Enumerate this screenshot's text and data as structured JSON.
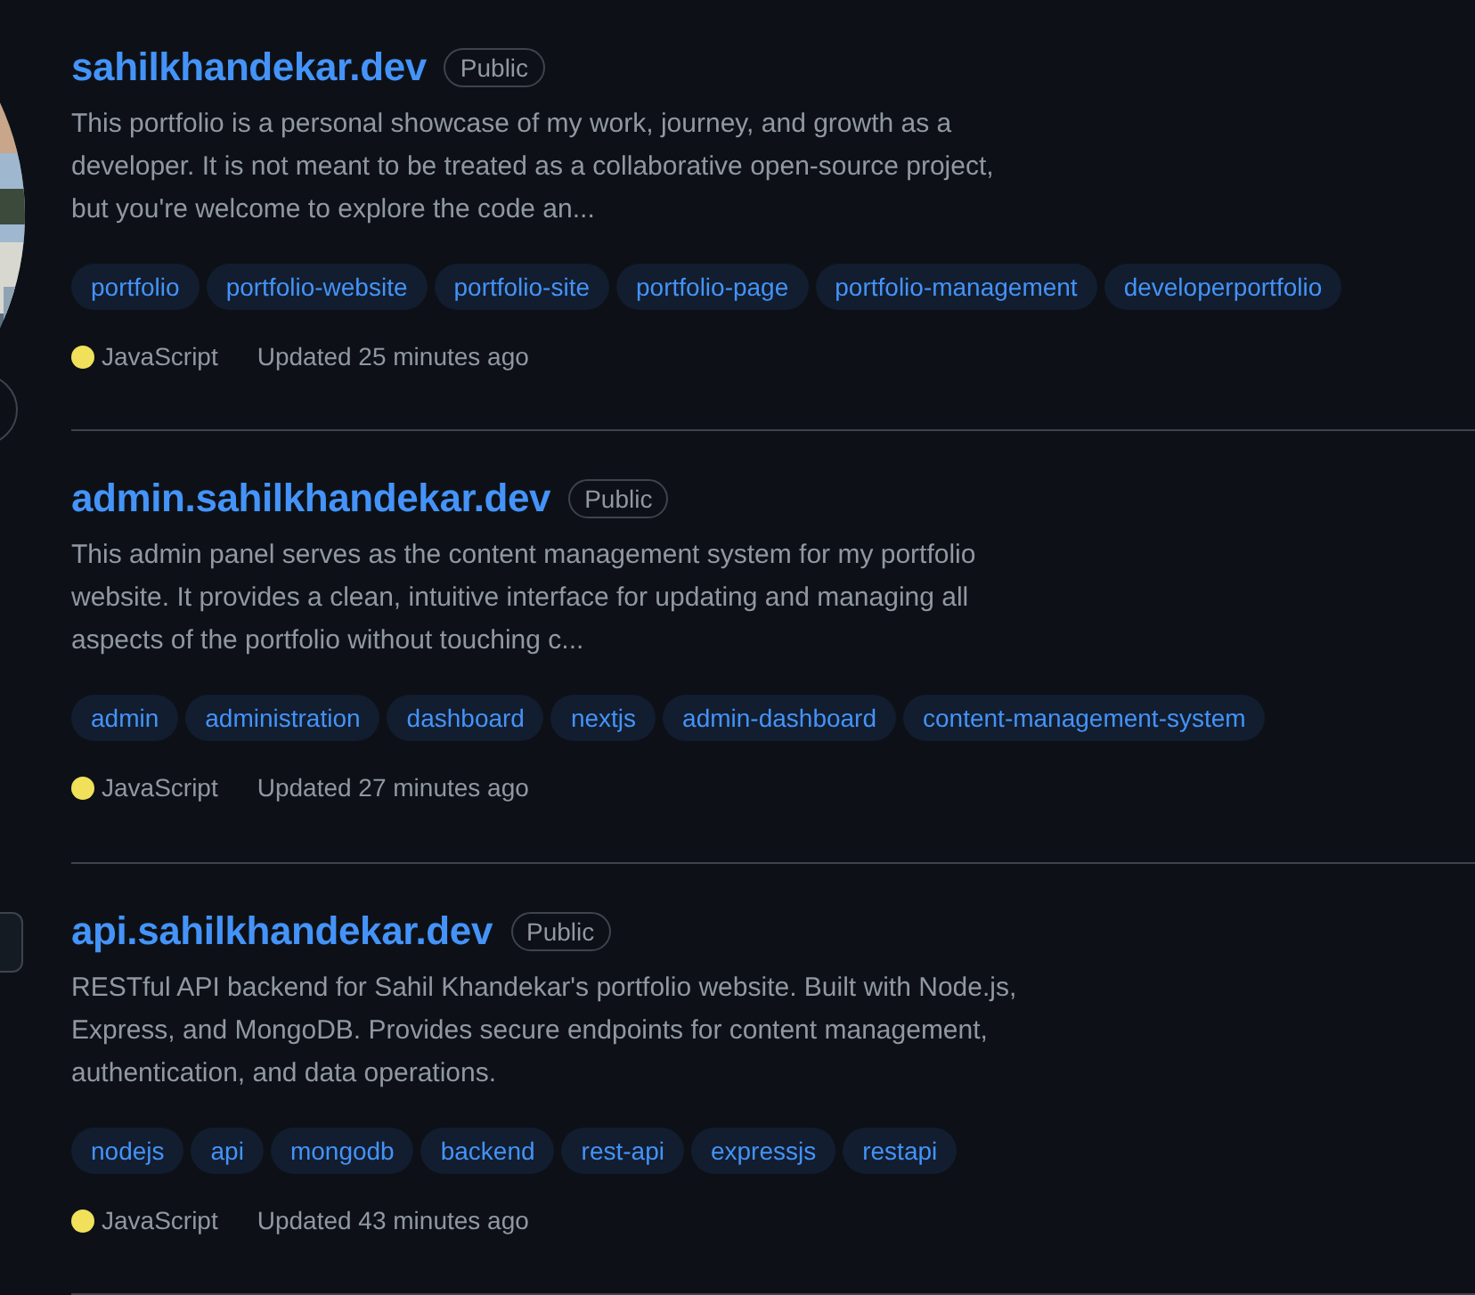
{
  "repositories": [
    {
      "name": "sahilkhandekar.dev",
      "visibility": "Public",
      "description": "This portfolio is a personal showcase of my work, journey, and growth as a developer. It is not meant to be treated as a collaborative open-source project, but you're welcome to explore the code an...",
      "topics": [
        "portfolio",
        "portfolio-website",
        "portfolio-site",
        "portfolio-page",
        "portfolio-management",
        "developerportfolio"
      ],
      "language": "JavaScript",
      "color": "#f1e05a",
      "updated": "Updated 25 minutes ago"
    },
    {
      "name": "admin.sahilkhandekar.dev",
      "visibility": "Public",
      "description": "This admin panel serves as the content management system for my portfolio website. It provides a clean, intuitive interface for updating and managing all aspects of the portfolio without touching c...",
      "topics": [
        "admin",
        "administration",
        "dashboard",
        "nextjs",
        "admin-dashboard",
        "content-management-system"
      ],
      "language": "JavaScript",
      "color": "#f1e05a",
      "updated": "Updated 27 minutes ago"
    },
    {
      "name": "api.sahilkhandekar.dev",
      "visibility": "Public",
      "description": "RESTful API backend for Sahil Khandekar's portfolio website. Built with Node.js, Express, and MongoDB. Provides secure endpoints for content management, authentication, and data operations.",
      "topics": [
        "nodejs",
        "api",
        "mongodb",
        "backend",
        "rest-api",
        "expressjs",
        "restapi"
      ],
      "language": "JavaScript",
      "color": "#f1e05a",
      "updated": "Updated 43 minutes ago"
    }
  ]
}
